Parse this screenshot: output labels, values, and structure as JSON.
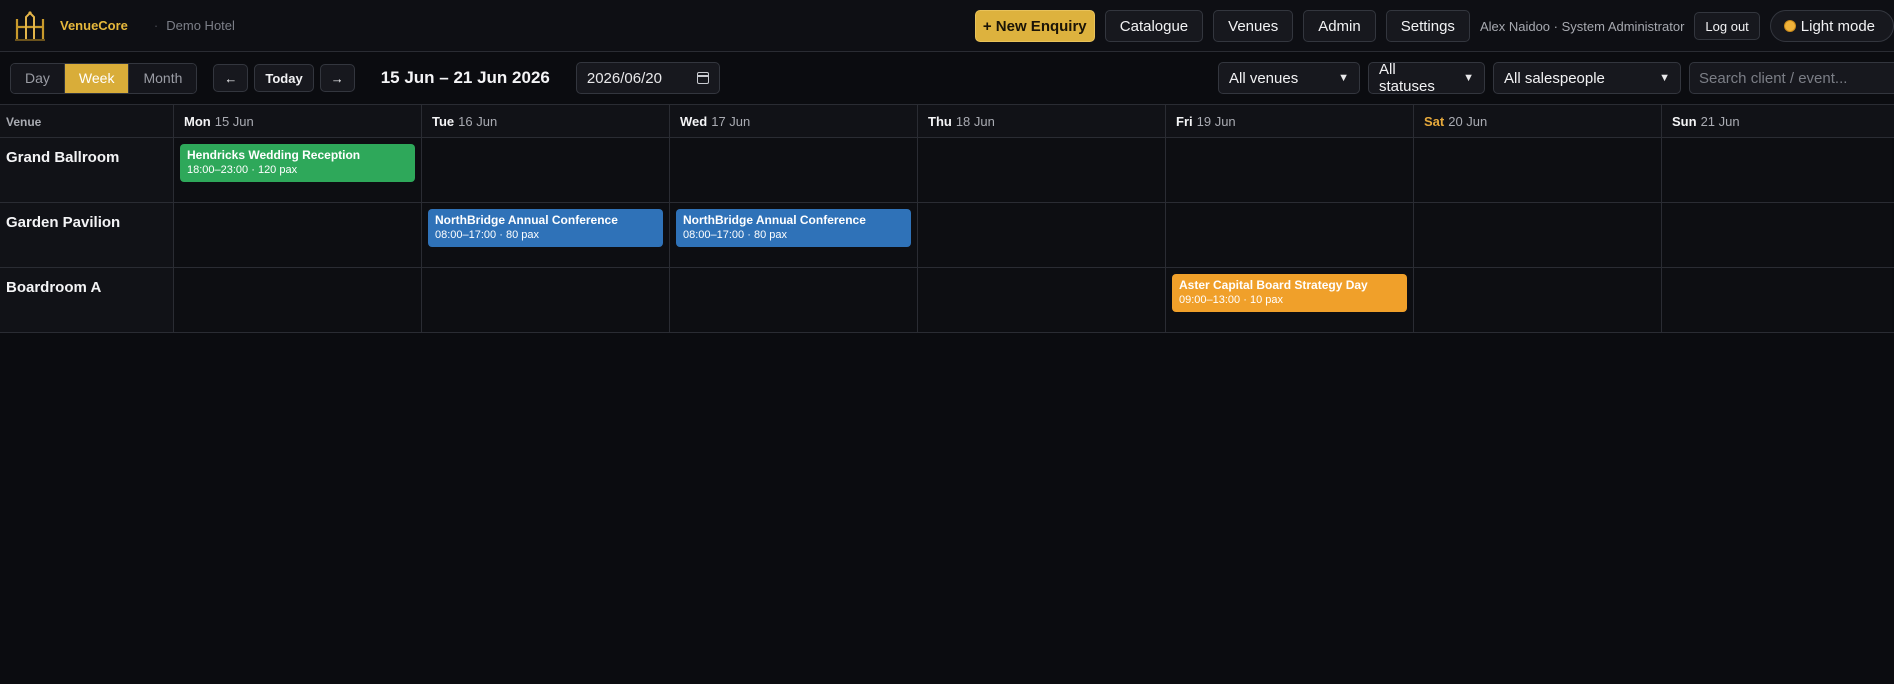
{
  "header": {
    "brand": "VenueCore",
    "hotel": "Demo Hotel",
    "new_enquiry": "+ New Enquiry",
    "nav": [
      "Catalogue",
      "Venues",
      "Admin",
      "Settings"
    ],
    "user": "Alex Naidoo · System Administrator",
    "logout": "Log out",
    "theme_toggle": "Light mode"
  },
  "toolbar": {
    "views": [
      "Day",
      "Week",
      "Month"
    ],
    "active_view": "Week",
    "prev": "←",
    "today": "Today",
    "next": "→",
    "range": "15 Jun – 21 Jun 2026",
    "date_value": "2026/06/20",
    "venue_filter": "All venues",
    "status_filter": "All statuses",
    "salesperson_filter": "All salespeople",
    "search_placeholder": "Search client / event..."
  },
  "grid": {
    "venue_header": "Venue",
    "days": [
      {
        "name": "Mon",
        "date": "15 Jun"
      },
      {
        "name": "Tue",
        "date": "16 Jun"
      },
      {
        "name": "Wed",
        "date": "17 Jun"
      },
      {
        "name": "Thu",
        "date": "18 Jun"
      },
      {
        "name": "Fri",
        "date": "19 Jun"
      },
      {
        "name": "Sat",
        "date": "20 Jun"
      },
      {
        "name": "Sun",
        "date": "21 Jun"
      }
    ],
    "rows": [
      {
        "venue": "Grand Ballroom",
        "events": [
          {
            "day": 0,
            "title": "Hendricks Wedding Reception",
            "detail": "18:00–23:00 · 120 pax",
            "color": "#2ea85a"
          }
        ]
      },
      {
        "venue": "Garden Pavilion",
        "events": [
          {
            "day": 1,
            "title": "NorthBridge Annual Conference",
            "detail": "08:00–17:00 · 80 pax",
            "color": "#2f72b8"
          },
          {
            "day": 2,
            "title": "NorthBridge Annual Conference",
            "detail": "08:00–17:00 · 80 pax",
            "color": "#2f72b8"
          }
        ]
      },
      {
        "venue": "Boardroom A",
        "events": [
          {
            "day": 4,
            "title": "Aster Capital Board Strategy Day",
            "detail": "09:00–13:00 · 10 pax",
            "color": "#f0a02a"
          }
        ]
      }
    ]
  },
  "colors": {
    "accent": "#ddb23e",
    "weekend": "#e6a93c"
  }
}
